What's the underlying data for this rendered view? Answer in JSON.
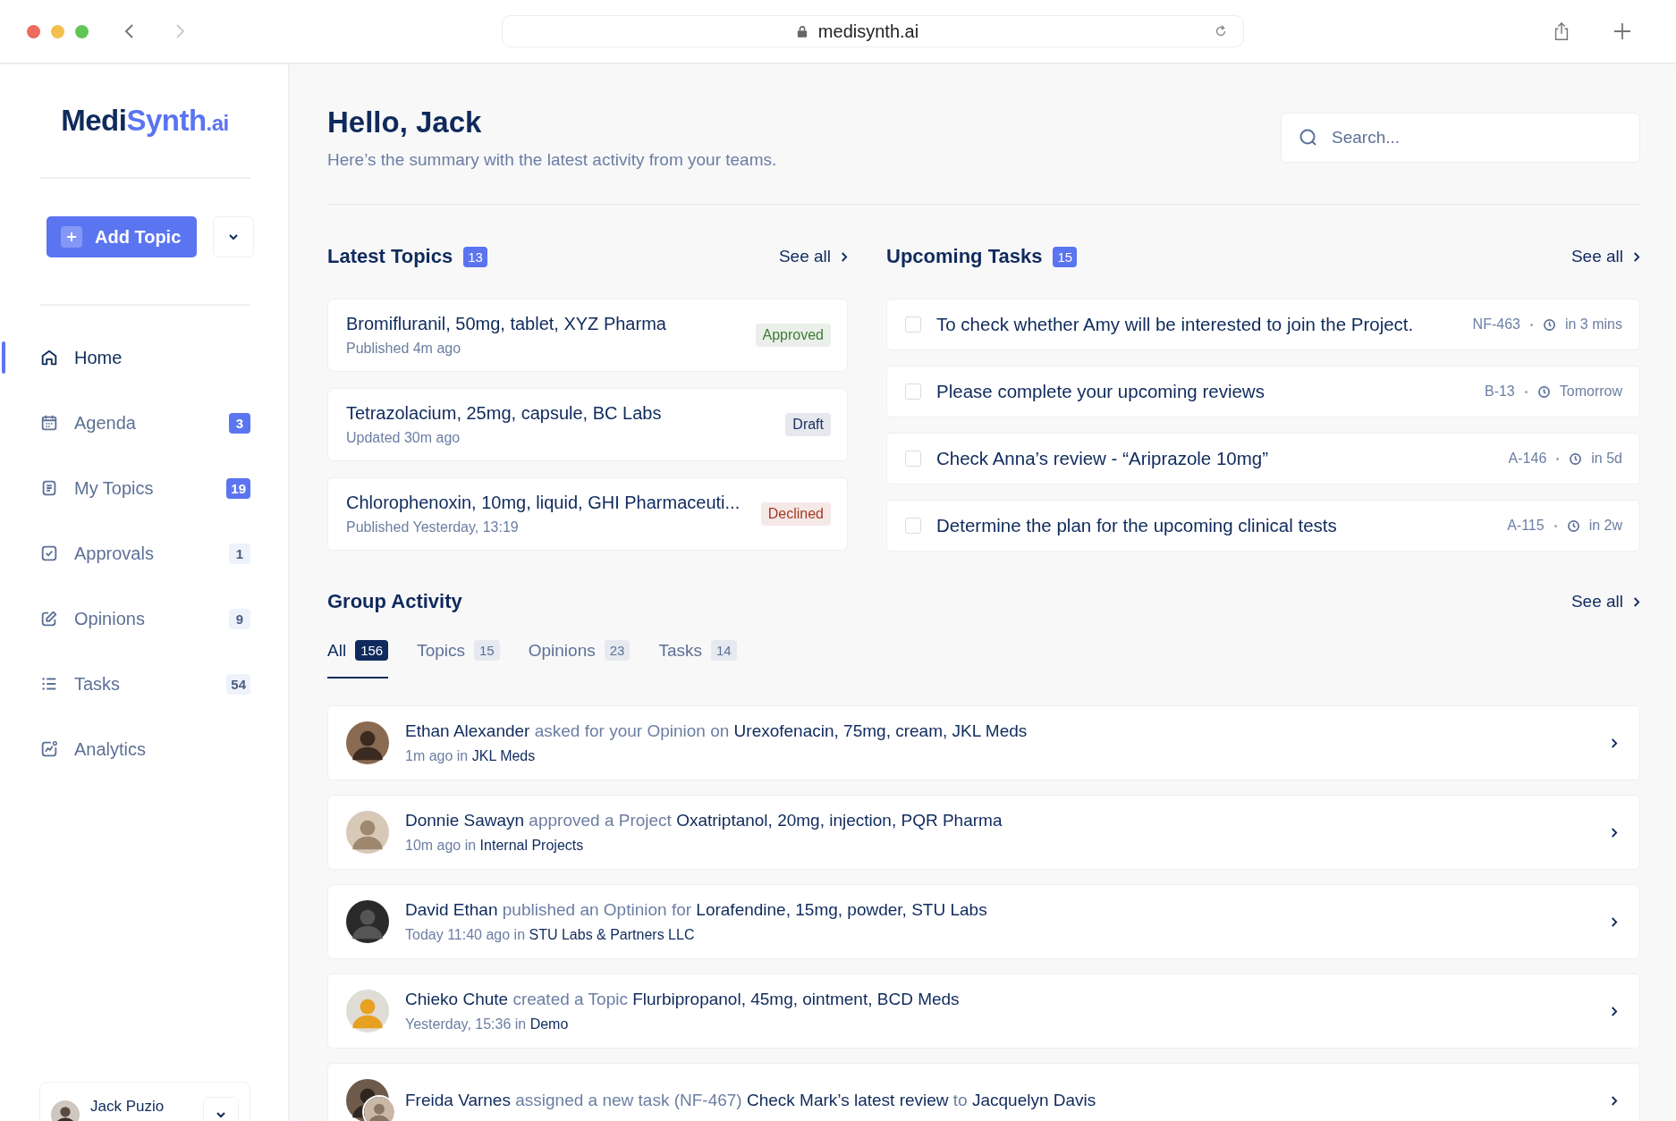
{
  "browser": {
    "url": "medisynth.ai"
  },
  "logo": {
    "parts": [
      "Medi",
      "Synth",
      ".ai"
    ]
  },
  "add_topic": {
    "label": "Add Topic"
  },
  "nav": [
    {
      "label": "Home",
      "selected": true
    },
    {
      "label": "Agenda",
      "badge": "3",
      "highlighted": true,
      "selected": false
    },
    {
      "label": "My Topics",
      "badge": "19",
      "highlighted": true,
      "selected": false
    },
    {
      "label": "Approvals",
      "badge": "1",
      "highlighted": false,
      "selected": false
    },
    {
      "label": "Opinions",
      "badge": "9",
      "highlighted": false,
      "selected": false
    },
    {
      "label": "Tasks",
      "badge": "54",
      "highlighted": false,
      "selected": false
    },
    {
      "label": "Analytics",
      "selected": false
    }
  ],
  "user": {
    "name": "Jack Puzio"
  },
  "greeting": {
    "title": "Hello, Jack",
    "subtitle": "Here’s the summary with the latest activity from your teams."
  },
  "search": {
    "placeholder": "Search..."
  },
  "latest_topics": {
    "title": "Latest Topics",
    "count": "13",
    "see_all": "See all",
    "items": [
      {
        "title": "Bromifluranil, 50mg, tablet, XYZ Pharma",
        "meta": "Published 4m ago",
        "color": "#3f7a37",
        "status_label": "Approved"
      },
      {
        "title": "Tetrazolacium, 25mg, capsule, BC Labs",
        "meta": "Updated 30m ago",
        "color": "#1c3260",
        "status_label": "Draft"
      },
      {
        "title": "Chlorophenoxin, 10mg, liquid, GHI Pharmaceuti...",
        "meta": "Published Yesterday, 13:19",
        "color": "#a33a25",
        "status_label": "Declined"
      }
    ]
  },
  "upcoming_tasks": {
    "title": "Upcoming Tasks",
    "count": "15",
    "see_all": "See all",
    "items": [
      {
        "title": "To check whether Amy will be interested to join the Project.",
        "checked": false,
        "code": "NF-463",
        "due": "in 3 mins"
      },
      {
        "title": "Please complete your upcoming reviews",
        "checked": false,
        "code": "B-13",
        "due": "Tomorrow"
      },
      {
        "title": "Check Anna’s review - “Ariprazole 10mg”",
        "checked": false,
        "code": "A-146",
        "due": "in 5d"
      },
      {
        "title": "Determine the plan for the upcoming clinical tests",
        "checked": false,
        "code": "A-115",
        "due": "in 2w"
      }
    ]
  },
  "group_activity": {
    "title": "Group Activity",
    "see_all": "See all",
    "tabs": [
      {
        "label": "All",
        "count": "156",
        "selected": true
      },
      {
        "label": "Topics",
        "count": "15",
        "selected": false
      },
      {
        "label": "Opinions",
        "count": "23",
        "selected": false
      },
      {
        "label": "Tasks",
        "count": "14",
        "selected": false
      }
    ],
    "items": [
      {
        "text": "**Ethan Alexander** asked for your Opinion on **Urexofenacin, 75mg, cream, JKL Meds**",
        "meta": "1m ago in **JKL Meds**",
        "kind": "single"
      },
      {
        "text": "**Donnie Sawayn** approved a Project **Oxatriptanol, 20mg, injection, PQR Pharma**",
        "meta": "10m ago in **Internal Projects**",
        "kind": "single"
      },
      {
        "text": "**David Ethan** published an Optinion for **Lorafendine, 15mg, powder, STU Labs**",
        "meta": "Today 11:40 ago in **STU Labs & Partners LLC**",
        "kind": "single"
      },
      {
        "text": "**Chieko Chute** created a Topic **Flurbipropanol, 45mg, ointment, BCD Meds**",
        "meta": "Yesterday, 15:36 in **Demo**",
        "kind": "single"
      },
      {
        "text": "**Freida Varnes** assigned a new task (NF-467) **Check Mark’s latest review** to **Jacquelyn Davis**",
        "kind": "pair"
      }
    ]
  }
}
